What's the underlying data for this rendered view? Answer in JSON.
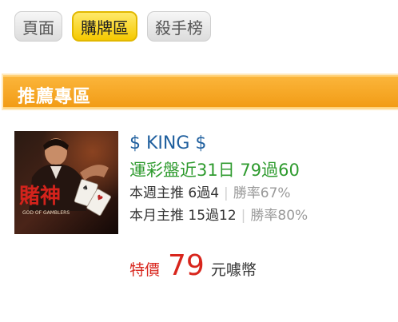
{
  "tabs": [
    {
      "label": "頁面",
      "active": false
    },
    {
      "label": "購牌區",
      "active": true
    },
    {
      "label": "殺手榜",
      "active": false
    }
  ],
  "section": {
    "title": "推薦專區"
  },
  "item": {
    "image_title_text": "賭神",
    "image_subtitle_text": "GOD OF GAMBLERS",
    "name": "$ KING $",
    "record": "運彩盤近31日 79過60",
    "weekly": {
      "label": "本週主推 6過4",
      "rate": "勝率67%"
    },
    "monthly": {
      "label": "本月主推 15過12",
      "rate": "勝率80%"
    },
    "price": {
      "label": "特價",
      "value": "79",
      "unit": "元噱幣"
    }
  },
  "colors": {
    "header": "#f29c16",
    "tab_active": "#f5c900",
    "name": "#1f5f9e",
    "record": "#2f9b2f",
    "price": "#d8251c"
  }
}
